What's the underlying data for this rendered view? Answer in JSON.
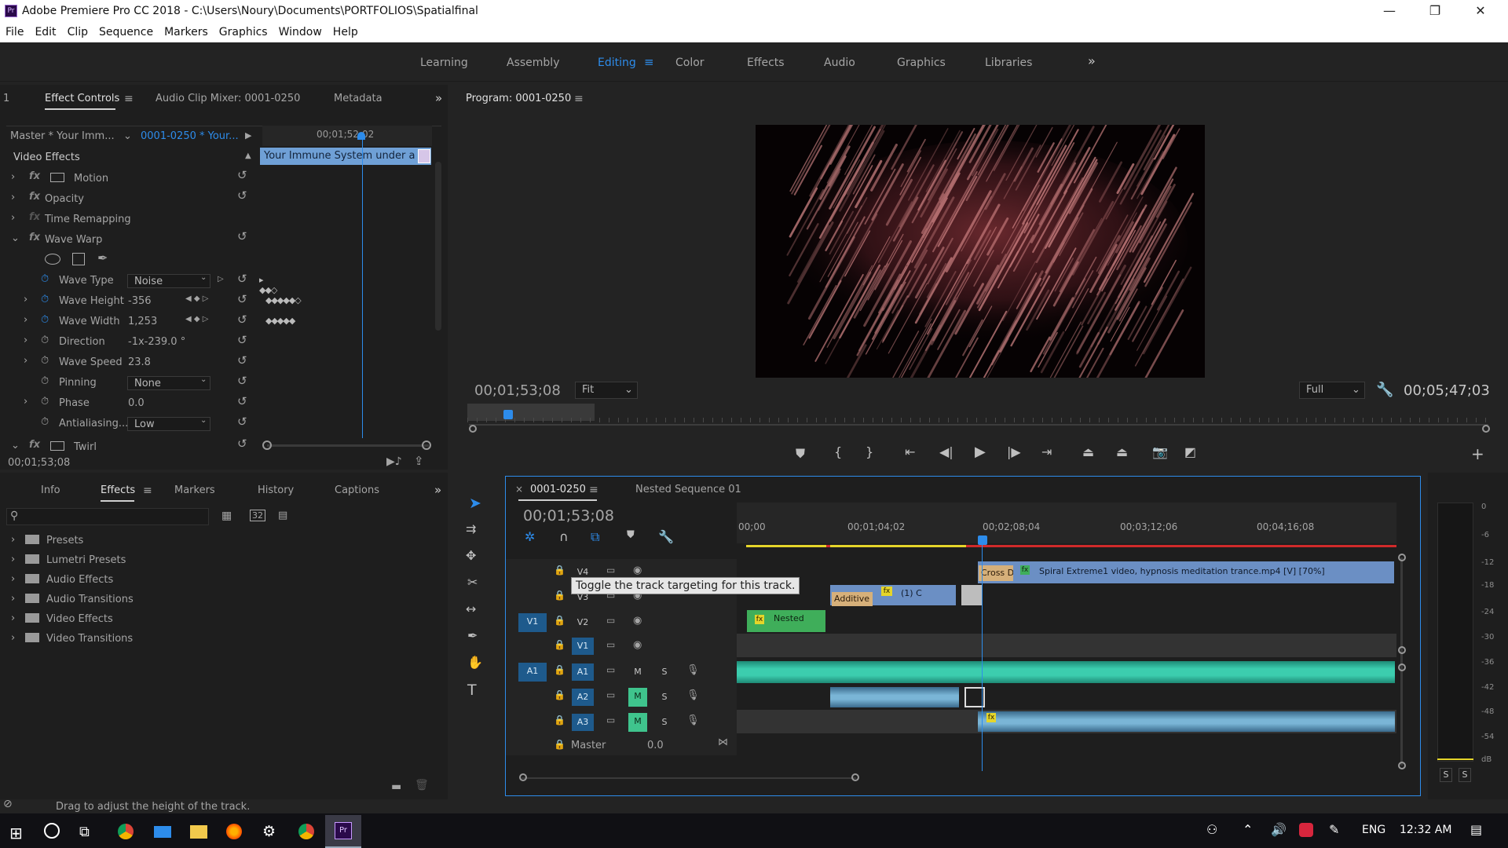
{
  "app": {
    "title": "Adobe Premiere Pro CC 2018 - C:\\Users\\Noury\\Documents\\PORTFOLIOS\\Spatialfinal",
    "logo": "Pr"
  },
  "window_controls": {
    "minimize": "—",
    "maximize": "❐",
    "close": "✕"
  },
  "menu": [
    "File",
    "Edit",
    "Clip",
    "Sequence",
    "Markers",
    "Graphics",
    "Window",
    "Help"
  ],
  "workspaces": {
    "items": [
      "Learning",
      "Assembly",
      "Editing",
      "Color",
      "Effects",
      "Audio",
      "Graphics",
      "Libraries"
    ],
    "active": "Editing",
    "more": "»"
  },
  "left_top_panel": {
    "tabs": [
      "Effect Controls",
      "Audio Clip Mixer: 0001-0250",
      "Metadata"
    ],
    "panel_number": "1",
    "master_label": "Master * Your Imm...",
    "clip_label": "0001-0250 * Your...",
    "ruler_time": "00;01;52;02",
    "clip_bar_text": "Your Immune System under a r",
    "section": "Video Effects",
    "effects": [
      {
        "name": "Motion",
        "type": "motion"
      },
      {
        "name": "Opacity",
        "type": "fx"
      },
      {
        "name": "Time Remapping",
        "type": "disabled"
      },
      {
        "name": "Wave Warp",
        "type": "fx"
      }
    ],
    "params": [
      {
        "name": "Wave Type",
        "value": "Noise",
        "kind": "dropdown",
        "kf": "▸ ◆◆◇"
      },
      {
        "name": "Wave Height",
        "value": "-356",
        "kind": "value",
        "kf": "◆◆◆◆◆◇"
      },
      {
        "name": "Wave Width",
        "value": "1,253",
        "kind": "value",
        "kf": "◆◆◆◆◆"
      },
      {
        "name": "Direction",
        "value": "-1x-239.0 °",
        "kind": "value",
        "kf": ""
      },
      {
        "name": "Wave Speed",
        "value": "23.8",
        "kind": "value",
        "kf": ""
      },
      {
        "name": "Pinning",
        "value": "None",
        "kind": "dropdown",
        "kf": ""
      },
      {
        "name": "Phase",
        "value": "0.0",
        "kind": "value",
        "kf": ""
      },
      {
        "name": "Antialiasing...",
        "value": "Low",
        "kind": "dropdown",
        "kf": ""
      }
    ],
    "twirl": "Twirl",
    "timecode": "00;01;53;08"
  },
  "left_bottom_panel": {
    "tabs": [
      "Info",
      "Effects",
      "Markers",
      "History",
      "Captions"
    ],
    "active": "Effects",
    "search_placeholder": "",
    "folders": [
      "Presets",
      "Lumetri Presets",
      "Audio Effects",
      "Audio Transitions",
      "Video Effects",
      "Video Transitions"
    ]
  },
  "program_monitor": {
    "title": "Program: 0001-0250",
    "timecode": "00;01;53;08",
    "fit": "Fit",
    "quality": "Full",
    "duration": "00;05;47;03"
  },
  "timeline": {
    "tabs": [
      "0001-0250",
      "Nested Sequence 01"
    ],
    "timecode": "00;01;53;08",
    "ruler": [
      "00;00",
      "00;01;04;02",
      "00;02;08;04",
      "00;03;12;06",
      "00;04;16;08"
    ],
    "tooltip": "Toggle the track targeting for this track.",
    "tracks": {
      "video": [
        "V4",
        "V3",
        "V2",
        "V1"
      ],
      "audio": [
        "A1",
        "A2",
        "A3"
      ],
      "source_v": "V1",
      "source_a": "A1"
    },
    "master_label": "Master",
    "master_value": "0.0",
    "clips": {
      "cross": "Cross D",
      "spiral": "Spiral Extreme1 video, hypnosis meditation trance.mp4 [V] [70%]",
      "additive": "Additive D",
      "v3_small": "(1) C",
      "nested": "Nested"
    },
    "toggles": {
      "mute": "M",
      "solo": "S"
    }
  },
  "meter": {
    "ticks": [
      "0",
      "-6",
      "-12",
      "-18",
      "-24",
      "-30",
      "-36",
      "-42",
      "-48",
      "-54",
      "dB"
    ],
    "solo_buttons": [
      "S",
      "S"
    ]
  },
  "status_bar": "Drag to adjust the height of the track.",
  "taskbar": {
    "lang": "ENG",
    "time": "12:32 AM"
  },
  "colors": {
    "accent_blue": "#2d8ceb",
    "clip_blue": "#6b8fc4",
    "clip_green": "#3fae5a",
    "audio_teal": "#3dd6b6",
    "audio_blue": "#7ab5d6",
    "work_yellow": "#e5d52a",
    "work_red": "#d02a2a"
  }
}
